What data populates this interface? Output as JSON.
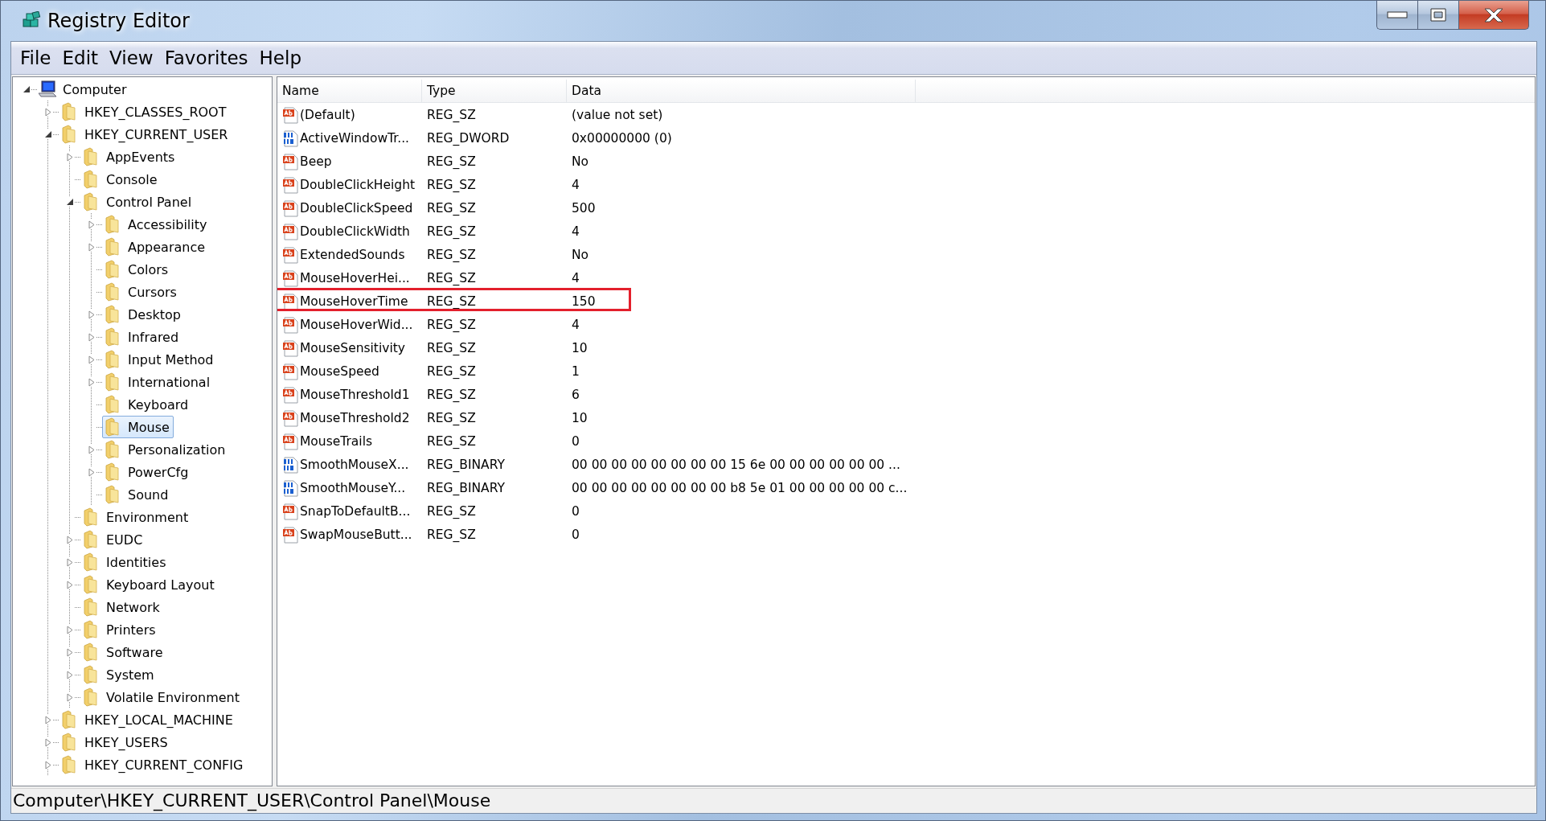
{
  "window": {
    "title": "Registry Editor"
  },
  "menu": [
    "File",
    "Edit",
    "View",
    "Favorites",
    "Help"
  ],
  "tree": {
    "label": "Computer",
    "kind": "computer",
    "expandable": true,
    "expanded": true,
    "selected": false,
    "children": [
      {
        "label": "HKEY_CLASSES_ROOT",
        "expandable": true,
        "expanded": false,
        "selected": false
      },
      {
        "label": "HKEY_CURRENT_USER",
        "expandable": true,
        "expanded": true,
        "selected": false,
        "children": [
          {
            "label": "AppEvents",
            "expandable": true,
            "expanded": false,
            "selected": false
          },
          {
            "label": "Console",
            "expandable": false,
            "selected": false
          },
          {
            "label": "Control Panel",
            "expandable": true,
            "expanded": true,
            "selected": false,
            "children": [
              {
                "label": "Accessibility",
                "expandable": true,
                "expanded": false,
                "selected": false
              },
              {
                "label": "Appearance",
                "expandable": true,
                "expanded": false,
                "selected": false
              },
              {
                "label": "Colors",
                "expandable": false,
                "selected": false
              },
              {
                "label": "Cursors",
                "expandable": false,
                "selected": false
              },
              {
                "label": "Desktop",
                "expandable": true,
                "expanded": false,
                "selected": false
              },
              {
                "label": "Infrared",
                "expandable": true,
                "expanded": false,
                "selected": false
              },
              {
                "label": "Input Method",
                "expandable": true,
                "expanded": false,
                "selected": false
              },
              {
                "label": "International",
                "expandable": true,
                "expanded": false,
                "selected": false
              },
              {
                "label": "Keyboard",
                "expandable": false,
                "selected": false
              },
              {
                "label": "Mouse",
                "expandable": false,
                "selected": true
              },
              {
                "label": "Personalization",
                "expandable": true,
                "expanded": false,
                "selected": false
              },
              {
                "label": "PowerCfg",
                "expandable": true,
                "expanded": false,
                "selected": false
              },
              {
                "label": "Sound",
                "expandable": false,
                "selected": false
              }
            ]
          },
          {
            "label": "Environment",
            "expandable": false,
            "selected": false
          },
          {
            "label": "EUDC",
            "expandable": true,
            "expanded": false,
            "selected": false
          },
          {
            "label": "Identities",
            "expandable": true,
            "expanded": false,
            "selected": false
          },
          {
            "label": "Keyboard Layout",
            "expandable": true,
            "expanded": false,
            "selected": false
          },
          {
            "label": "Network",
            "expandable": false,
            "selected": false
          },
          {
            "label": "Printers",
            "expandable": true,
            "expanded": false,
            "selected": false
          },
          {
            "label": "Software",
            "expandable": true,
            "expanded": false,
            "selected": false
          },
          {
            "label": "System",
            "expandable": true,
            "expanded": false,
            "selected": false
          },
          {
            "label": "Volatile Environment",
            "expandable": true,
            "expanded": false,
            "selected": false
          }
        ]
      },
      {
        "label": "HKEY_LOCAL_MACHINE",
        "expandable": true,
        "expanded": false,
        "selected": false
      },
      {
        "label": "HKEY_USERS",
        "expandable": true,
        "expanded": false,
        "selected": false
      },
      {
        "label": "HKEY_CURRENT_CONFIG",
        "expandable": true,
        "expanded": false,
        "selected": false
      }
    ]
  },
  "values": {
    "columns": [
      "Name",
      "Type",
      "Data"
    ],
    "rows": [
      {
        "name": "(Default)",
        "type": "REG_SZ",
        "data": "(value not set)",
        "kind": "string",
        "highlighted": false
      },
      {
        "name": "ActiveWindowTr...",
        "type": "REG_DWORD",
        "data": "0x00000000 (0)",
        "kind": "binary",
        "highlighted": false
      },
      {
        "name": "Beep",
        "type": "REG_SZ",
        "data": "No",
        "kind": "string",
        "highlighted": false
      },
      {
        "name": "DoubleClickHeight",
        "type": "REG_SZ",
        "data": "4",
        "kind": "string",
        "highlighted": false
      },
      {
        "name": "DoubleClickSpeed",
        "type": "REG_SZ",
        "data": "500",
        "kind": "string",
        "highlighted": false
      },
      {
        "name": "DoubleClickWidth",
        "type": "REG_SZ",
        "data": "4",
        "kind": "string",
        "highlighted": false
      },
      {
        "name": "ExtendedSounds",
        "type": "REG_SZ",
        "data": "No",
        "kind": "string",
        "highlighted": false
      },
      {
        "name": "MouseHoverHei...",
        "type": "REG_SZ",
        "data": "4",
        "kind": "string",
        "highlighted": false
      },
      {
        "name": "MouseHoverTime",
        "type": "REG_SZ",
        "data": "150",
        "kind": "string",
        "highlighted": true
      },
      {
        "name": "MouseHoverWid...",
        "type": "REG_SZ",
        "data": "4",
        "kind": "string",
        "highlighted": false
      },
      {
        "name": "MouseSensitivity",
        "type": "REG_SZ",
        "data": "10",
        "kind": "string",
        "highlighted": false
      },
      {
        "name": "MouseSpeed",
        "type": "REG_SZ",
        "data": "1",
        "kind": "string",
        "highlighted": false
      },
      {
        "name": "MouseThreshold1",
        "type": "REG_SZ",
        "data": "6",
        "kind": "string",
        "highlighted": false
      },
      {
        "name": "MouseThreshold2",
        "type": "REG_SZ",
        "data": "10",
        "kind": "string",
        "highlighted": false
      },
      {
        "name": "MouseTrails",
        "type": "REG_SZ",
        "data": "0",
        "kind": "string",
        "highlighted": false
      },
      {
        "name": "SmoothMouseX...",
        "type": "REG_BINARY",
        "data": "00 00 00 00 00 00 00 00 15 6e 00 00 00 00 00 00 ...",
        "kind": "binary",
        "highlighted": false
      },
      {
        "name": "SmoothMouseY...",
        "type": "REG_BINARY",
        "data": "00 00 00 00 00 00 00 00 b8 5e 01 00 00 00 00 00 c...",
        "kind": "binary",
        "highlighted": false
      },
      {
        "name": "SnapToDefaultB...",
        "type": "REG_SZ",
        "data": "0",
        "kind": "string",
        "highlighted": false
      },
      {
        "name": "SwapMouseButt...",
        "type": "REG_SZ",
        "data": "0",
        "kind": "string",
        "highlighted": false
      }
    ]
  },
  "status_bar": "Computer\\HKEY_CURRENT_USER\\Control Panel\\Mouse"
}
